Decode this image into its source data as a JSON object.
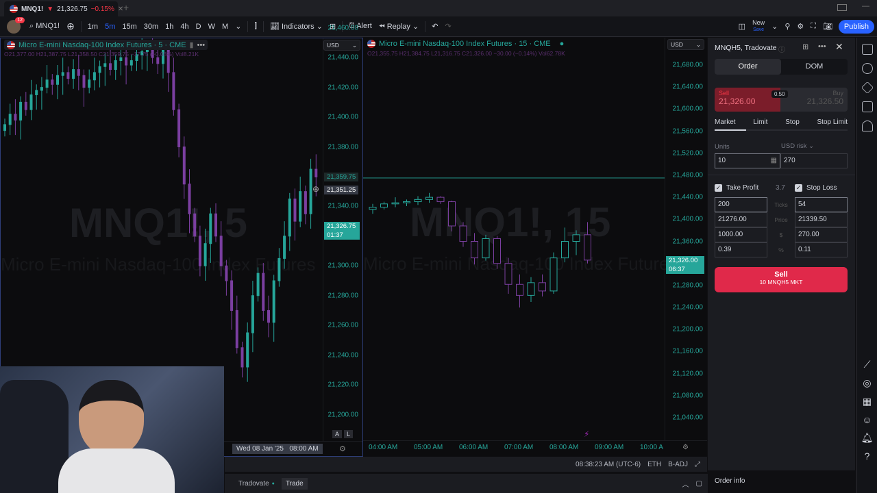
{
  "tab": {
    "symbol": "MNQ1!",
    "arrow": "▼",
    "price": "21,326.75",
    "change": "−0.15%"
  },
  "toolbar": {
    "badge": "12",
    "symbol": "MNQ1!",
    "intervals": [
      "1m",
      "5m",
      "15m",
      "30m",
      "1h",
      "4h",
      "D",
      "W",
      "M"
    ],
    "active_interval": "5m",
    "indicators": "Indicators",
    "alert": "Alert",
    "replay": "Replay",
    "new": "New",
    "save": "Save",
    "publish": "Publish"
  },
  "left_chart": {
    "title": "Micro E-mini Nasdaq-100 Index Futures · 5 · CME",
    "currency": "USD",
    "ohlc": "O21,377.00 H21,387.75 L21,358.50 C21,359.75 −17.75 (−0.08%) Vol8.21K",
    "watermark": "MNQ1!, 5",
    "watermark_sub": "Micro E-mini Nasdaq-100 Index Futures",
    "price_ticks": [
      "21,460.00",
      "21,440.00",
      "21,420.00",
      "21,400.00",
      "21,380.00",
      "21,340.00",
      "21,300.00",
      "21,280.00",
      "21,260.00",
      "21,240.00",
      "21,220.00",
      "21,200.00"
    ],
    "price_range": [
      21200,
      21470
    ],
    "tags": {
      "last": "21,359.75",
      "cursor": "21,351.25",
      "live": "21,326.75",
      "countdown": "01:37"
    },
    "cursor_time": "Wed 08 Jan '25   08:00 AM",
    "btn_a": "A",
    "btn_l": "L",
    "closes": [
      21395,
      21402,
      21398,
      21410,
      21405,
      21415,
      21418,
      21420,
      21425,
      21422,
      21428,
      21430,
      21426,
      21432,
      21428,
      21420,
      21425,
      21430,
      21434,
      21436,
      21432,
      21438,
      21440,
      21435,
      21438,
      21442,
      21444,
      21446,
      21440,
      21436,
      21445,
      21430,
      21405,
      21380,
      21355,
      21335,
      21320,
      21300,
      21315,
      21335,
      21320,
      21300,
      21290,
      21270,
      21245,
      21232,
      21255,
      21280,
      21295,
      21270,
      21262,
      21290,
      21305,
      21320,
      21345,
      21330,
      21350,
      21335,
      21365,
      21359.75
    ]
  },
  "right_chart": {
    "title": "Micro E-mini Nasdaq-100 Index Futures · 15 · CME",
    "currency": "USD",
    "ohlc": "O21,355.75 H21,384.75 L21,316.75 C21,326.00 −30.00 (−0.14%) Vol62.78K",
    "watermark": "MNQ1!, 15",
    "watermark_sub": "Micro E-mini Nasdaq-100 Index Futures",
    "price_ticks": [
      "21,680.00",
      "21,640.00",
      "21,600.00",
      "21,560.00",
      "21,520.00",
      "21,480.00",
      "21,440.00",
      "21,400.00",
      "21,360.00",
      "21,280.00",
      "21,240.00",
      "21,200.00",
      "21,160.00",
      "21,120.00",
      "21,080.00",
      "21,040.00"
    ],
    "price_range": [
      21040,
      21680
    ],
    "tags": {
      "live": "21,326.00",
      "countdown": "06:37"
    },
    "hline": 21475,
    "time_ticks": [
      "04:00 AM",
      "05:00 AM",
      "06:00 AM",
      "07:00 AM",
      "08:00 AM",
      "09:00 AM",
      "10:00 A"
    ],
    "candles": [
      [
        21418,
        21428,
        21410,
        21422
      ],
      [
        21422,
        21432,
        21418,
        21428
      ],
      [
        21428,
        21440,
        21422,
        21430
      ],
      [
        21430,
        21436,
        21424,
        21432
      ],
      [
        21432,
        21442,
        21426,
        21436
      ],
      [
        21436,
        21448,
        21430,
        21440
      ],
      [
        21440,
        21442,
        21428,
        21432
      ],
      [
        21432,
        21434,
        21378,
        21388
      ],
      [
        21388,
        21395,
        21350,
        21360
      ],
      [
        21360,
        21375,
        21318,
        21330
      ],
      [
        21330,
        21372,
        21325,
        21365
      ],
      [
        21365,
        21370,
        21310,
        21320
      ],
      [
        21320,
        21330,
        21265,
        21282
      ],
      [
        21282,
        21300,
        21240,
        21262
      ],
      [
        21262,
        21295,
        21250,
        21285
      ],
      [
        21285,
        21300,
        21260,
        21270
      ],
      [
        21270,
        21340,
        21265,
        21330
      ],
      [
        21330,
        21385,
        21322,
        21360
      ],
      [
        21360,
        21380,
        21335,
        21372
      ],
      [
        21372,
        21395,
        21320,
        21326
      ]
    ]
  },
  "status": {
    "time": "08:38:23 AM (UTC-6)",
    "session": "ETH",
    "adj": "B-ADJ"
  },
  "bottom": {
    "broker": "Tradovate",
    "trade": "Trade"
  },
  "order_panel": {
    "title": "MNQH5, Tradovate",
    "tabs": [
      "Order",
      "DOM"
    ],
    "sell_label": "Sell",
    "sell_price": "21,326.00",
    "spread": "0.50",
    "buy_label": "Buy",
    "buy_price": "21,326.50",
    "types": [
      "Market",
      "Limit",
      "Stop",
      "Stop Limit"
    ],
    "units_label": "Units",
    "units": "10",
    "risk_label": "USD risk",
    "risk": "270",
    "tp_label": "Take Profit",
    "rr": "3.7",
    "sl_label": "Stop Loss",
    "row_labels": [
      "Ticks",
      "Price",
      "$",
      "%"
    ],
    "tp": [
      "200",
      "21276.00",
      "1000.00",
      "0.39"
    ],
    "sl": [
      "54",
      "21339.50",
      "270.00",
      "0.11"
    ],
    "submit": "Sell",
    "submit_sub": "10 MNQH5 MKT",
    "order_info": "Order info"
  },
  "colors": {
    "up": "#26a69a",
    "down": "#7b3fa0",
    "sell": "#e0294a",
    "accent": "#2962ff"
  }
}
